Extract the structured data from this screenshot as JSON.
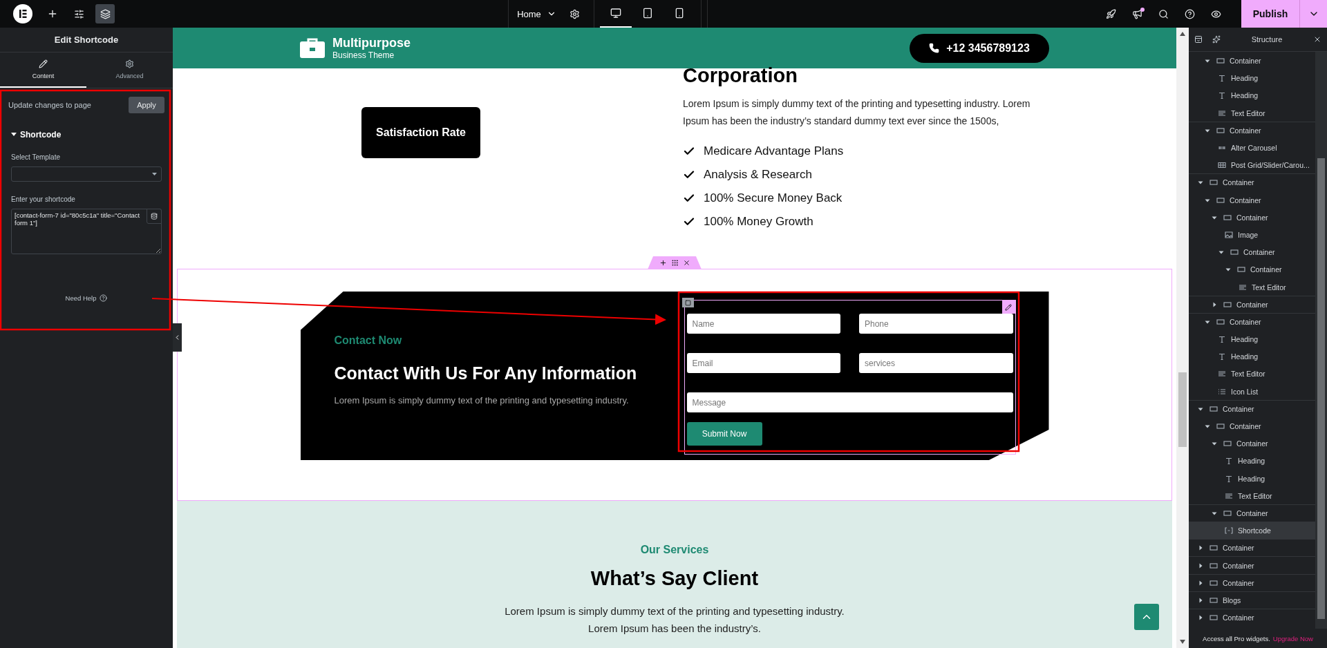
{
  "topbar": {
    "tools": [
      {
        "kind": "add",
        "selected": false
      },
      {
        "kind": "settings",
        "selected": false
      },
      {
        "kind": "layers",
        "selected": true
      }
    ],
    "page_menu": "Home",
    "devices": [
      {
        "kind": "desktop",
        "selected": true
      },
      {
        "kind": "tablet",
        "selected": false
      },
      {
        "kind": "mobile",
        "selected": false
      }
    ],
    "publish": "Publish"
  },
  "panel": {
    "title": "Edit Shortcode",
    "tabs": [
      {
        "label": "Content",
        "kind": "content",
        "selected": true
      },
      {
        "label": "Advanced",
        "kind": "advanced",
        "selected": false
      }
    ],
    "update_label": "Update changes to page",
    "apply": "Apply",
    "section": {
      "title": "Shortcode",
      "expanded": true
    },
    "template_label": "Select Template",
    "shortcode_label": "Enter your shortcode",
    "shortcode_value": "[contact-form-7 id=\"80c5c1a\" title=\"Contact form 1\"]",
    "help": "Need Help"
  },
  "site_header": {
    "brand": "Multipurpose",
    "tagline": "Business Theme",
    "phone": "+12 3456789123"
  },
  "about": {
    "badge": "Satisfaction Rate",
    "heading": "Corporation",
    "text": "Lorem Ipsum is simply dummy text of the printing and typesetting industry. Lorem Ipsum has been the industry’s standard dummy text ever since the 1500s,",
    "features": [
      "Medicare Advantage Plans",
      "Analysis & Research",
      "100% Secure Money Back",
      "100% Money Growth"
    ]
  },
  "contact": {
    "eyebrow": "Contact Now",
    "heading": "Contact With Us For Any Information",
    "text": "Lorem Ipsum is simply dummy text of the printing and typesetting industry.",
    "fields": [
      {
        "placeholder": "Name",
        "kind": "half"
      },
      {
        "placeholder": "Phone",
        "kind": "half"
      },
      {
        "placeholder": "Email",
        "kind": "half"
      },
      {
        "placeholder": "services",
        "kind": "half"
      },
      {
        "placeholder": "Message",
        "kind": "full"
      }
    ],
    "submit": "Submit Now"
  },
  "services": {
    "eyebrow": "Our Services",
    "heading": "What’s Say Client",
    "lines": [
      "Lorem Ipsum is simply dummy text of the printing and typesetting industry.",
      "Lorem Ipsum has been the industry’s."
    ]
  },
  "structure": {
    "title": "Structure",
    "tree": [
      {
        "children": [
          {
            "label": "Container",
            "kind": "container",
            "expanded": true,
            "selected": false,
            "children": [
              {
                "label": "Heading",
                "kind": "heading",
                "selected": false
              },
              {
                "label": "Heading",
                "kind": "heading",
                "selected": false
              },
              {
                "label": "Text Editor",
                "kind": "text",
                "selected": false
              }
            ]
          },
          {
            "label": "Container",
            "kind": "container",
            "expanded": true,
            "selected": false,
            "children": [
              {
                "label": "Alter Carousel",
                "kind": "carousel",
                "selected": false
              },
              {
                "label": "Post Grid/Slider/Carou...",
                "kind": "grid",
                "selected": false
              }
            ]
          }
        ]
      },
      {
        "label": "Container",
        "kind": "container",
        "expanded": true,
        "selected": false,
        "children": [
          {
            "label": "Container",
            "kind": "container",
            "expanded": true,
            "selected": false,
            "children": [
              {
                "label": "Container",
                "kind": "container",
                "expanded": true,
                "selected": false,
                "children": [
                  {
                    "label": "Image",
                    "kind": "image",
                    "selected": false
                  },
                  {
                    "label": "Container",
                    "kind": "container",
                    "expanded": true,
                    "selected": false,
                    "children": [
                      {
                        "label": "Container",
                        "kind": "container",
                        "expanded": true,
                        "selected": false,
                        "children": [
                          {
                            "label": "Text Editor",
                            "kind": "text",
                            "selected": false
                          }
                        ]
                      }
                    ]
                  }
                ]
              },
              {
                "label": "Container",
                "kind": "container",
                "expanded": false,
                "selected": false
              }
            ]
          },
          {
            "label": "Container",
            "kind": "container",
            "expanded": true,
            "selected": false,
            "children": [
              {
                "label": "Heading",
                "kind": "heading",
                "selected": false
              },
              {
                "label": "Heading",
                "kind": "heading",
                "selected": false
              },
              {
                "label": "Text Editor",
                "kind": "text",
                "selected": false
              },
              {
                "label": "Icon List",
                "kind": "list",
                "selected": false
              }
            ]
          }
        ]
      },
      {
        "label": "Container",
        "kind": "container",
        "expanded": true,
        "selected": false,
        "children": [
          {
            "label": "Container",
            "kind": "container",
            "expanded": true,
            "selected": false,
            "children": [
              {
                "label": "Container",
                "kind": "container",
                "expanded": true,
                "selected": false,
                "children": [
                  {
                    "label": "Heading",
                    "kind": "heading",
                    "selected": false
                  },
                  {
                    "label": "Heading",
                    "kind": "heading",
                    "selected": false
                  },
                  {
                    "label": "Text Editor",
                    "kind": "text",
                    "selected": false
                  }
                ]
              },
              {
                "label": "Container",
                "kind": "container",
                "expanded": true,
                "selected": false,
                "children": [
                  {
                    "label": "Shortcode",
                    "kind": "shortcode",
                    "selected": true
                  }
                ]
              }
            ]
          }
        ]
      },
      {
        "label": "Container",
        "kind": "container",
        "expanded": false,
        "selected": false
      },
      {
        "label": "Container",
        "kind": "container",
        "expanded": false,
        "selected": false
      },
      {
        "label": "Container",
        "kind": "container",
        "expanded": false,
        "selected": false
      },
      {
        "label": "Blogs",
        "kind": "container",
        "expanded": false,
        "selected": false
      },
      {
        "label": "Container",
        "kind": "container",
        "expanded": false,
        "selected": false
      }
    ],
    "footer": "Access all Pro widgets.",
    "upgrade": "Upgrade Now"
  }
}
